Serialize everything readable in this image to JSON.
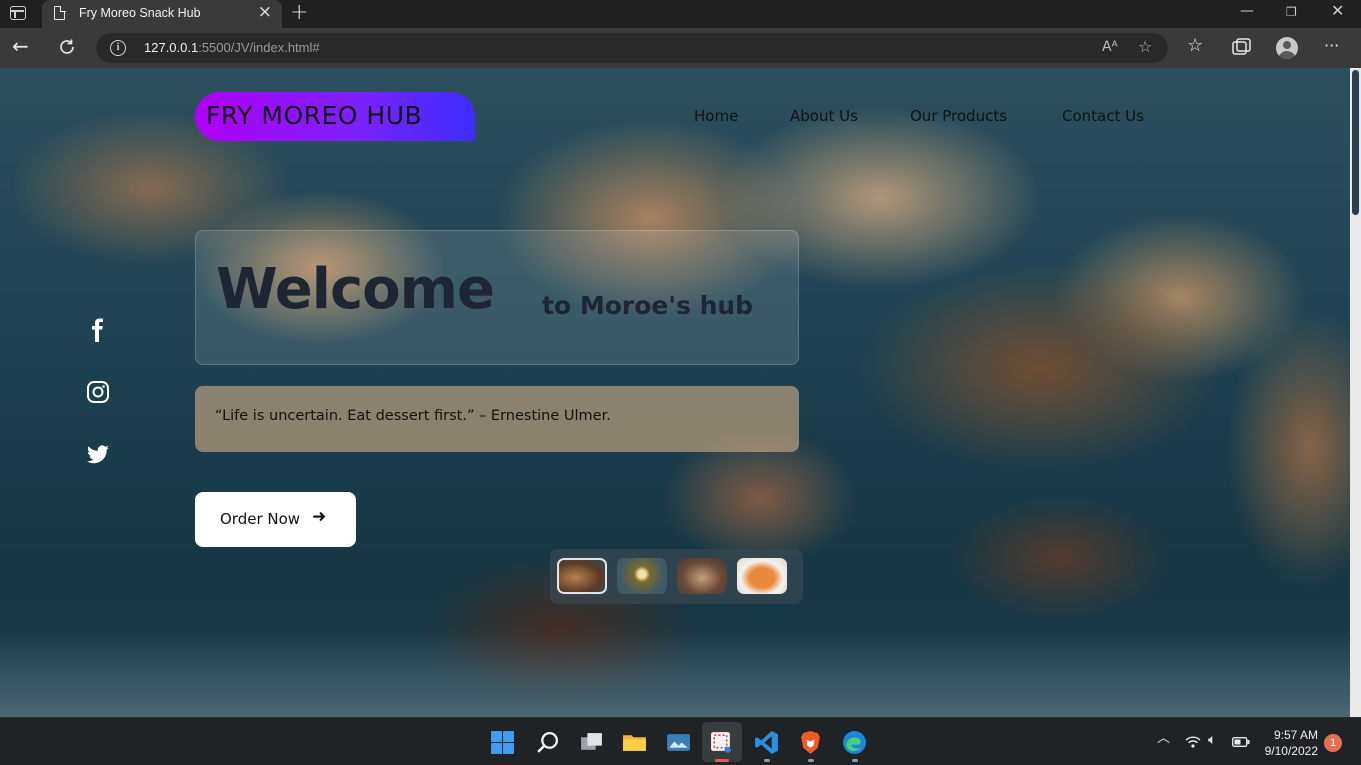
{
  "browser": {
    "tab_title": "Fry Moreo Snack Hub",
    "tab_close_icon": "close-icon",
    "new_tab_label": "+",
    "address_host": "127.0.0.1",
    "address_path": ":5500/JV/index.html#",
    "window_controls": [
      "minimize",
      "restore",
      "close"
    ]
  },
  "site": {
    "logo": "FRY MOREO HUB",
    "menu": [
      "Home",
      "About Us",
      "Our Products",
      "Contact Us"
    ],
    "welcome_big": "Welcome",
    "welcome_small": "to Moroe's hub",
    "quote": "“Life is uncertain. Eat dessert first.” – Ernestine Ulmer.",
    "order_label": "Order Now",
    "order_icon": "arrow-right-icon",
    "social": [
      "facebook-icon",
      "instagram-icon",
      "twitter-icon"
    ],
    "thumbnails": [
      "fried-oreos-thumb",
      "snack-plate-thumb",
      "cookies-thumb",
      "chips-bowl-thumb"
    ]
  },
  "taskbar": {
    "apps": [
      "windows-start-icon",
      "search-icon",
      "task-view-icon",
      "file-explorer-icon",
      "photos-icon",
      "snipping-tool-icon",
      "vscode-icon",
      "brave-icon",
      "edge-icon"
    ],
    "time": "9:57 AM",
    "date": "9/10/2022",
    "notification_count": "1"
  },
  "colors": {
    "logo_gradient_start": "#b000f5",
    "logo_gradient_end": "#3c2cff",
    "heading": "#1e2634",
    "page_bg": "#1f4352"
  }
}
